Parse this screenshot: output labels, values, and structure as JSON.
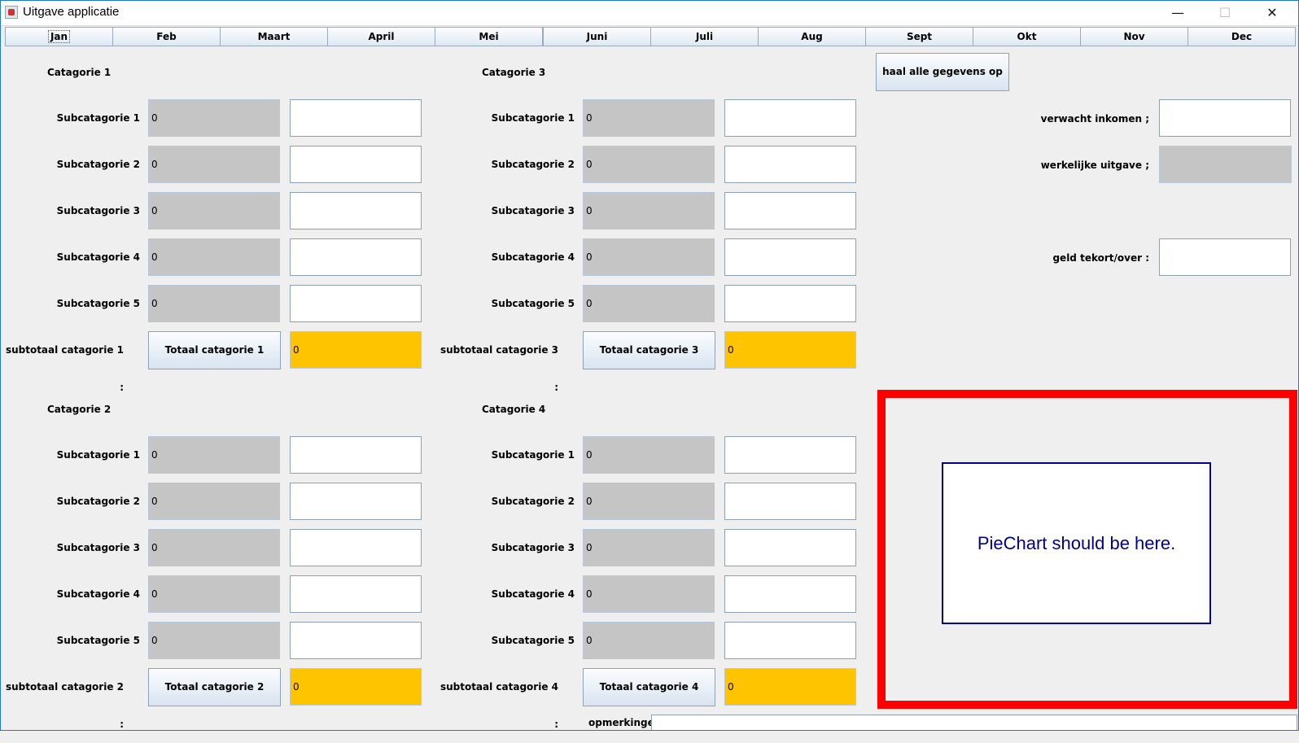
{
  "window": {
    "title": "Uitgave applicatie",
    "minimize": "—",
    "maximize": "☐",
    "close": "✕"
  },
  "months": [
    "Jan",
    "Feb",
    "Maart",
    "April",
    "Mei",
    "Juni",
    "Juli",
    "Aug",
    "Sept",
    "Okt",
    "Nov",
    "Dec"
  ],
  "categories": {
    "c1": {
      "title": "Catagorie 1",
      "subtotal_label": "subtotaal catagorie 1 :",
      "button": "Totaal catagorie 1",
      "total": "0",
      "subs": [
        "Subcatagorie 1",
        "Subcatagorie 2",
        "Subcatagorie 3",
        "Subcatagorie 4",
        "Subcatagorie 5"
      ],
      "values": [
        "0",
        "0",
        "0",
        "0",
        "0"
      ]
    },
    "c2": {
      "title": "Catagorie 2",
      "subtotal_label": "subtotaal catagorie 2 :",
      "button": "Totaal catagorie 2",
      "total": "0",
      "subs": [
        "Subcatagorie 1",
        "Subcatagorie 2",
        "Subcatagorie 3",
        "Subcatagorie 4",
        "Subcatagorie 5"
      ],
      "values": [
        "0",
        "0",
        "0",
        "0",
        "0"
      ]
    },
    "c3": {
      "title": "Catagorie 3",
      "subtotal_label": "subtotaal catagorie 3 :",
      "button": "Totaal catagorie 3",
      "total": "0",
      "subs": [
        "Subcatagorie 1",
        "Subcatagorie 2",
        "Subcatagorie 3",
        "Subcatagorie 4",
        "Subcatagorie 5"
      ],
      "values": [
        "0",
        "0",
        "0",
        "0",
        "0"
      ]
    },
    "c4": {
      "title": "Catagorie 4",
      "subtotal_label": "subtotaal catagorie 4 :",
      "button": "Totaal catagorie 4",
      "total": "0",
      "subs": [
        "Subcatagorie 1",
        "Subcatagorie 2",
        "Subcatagorie 3",
        "Subcatagorie 4",
        "Subcatagorie 5"
      ],
      "values": [
        "0",
        "0",
        "0",
        "0",
        "0"
      ]
    }
  },
  "right": {
    "fetch_button": "haal alle gegevens op",
    "expected_income_label": "verwacht inkomen ;",
    "actual_expense_label": "werkelijke uitgave ;",
    "shortage_label": "geld tekort/over :"
  },
  "pie_placeholder": "PieChart should be here.",
  "remarks_label": "opmerkingen"
}
